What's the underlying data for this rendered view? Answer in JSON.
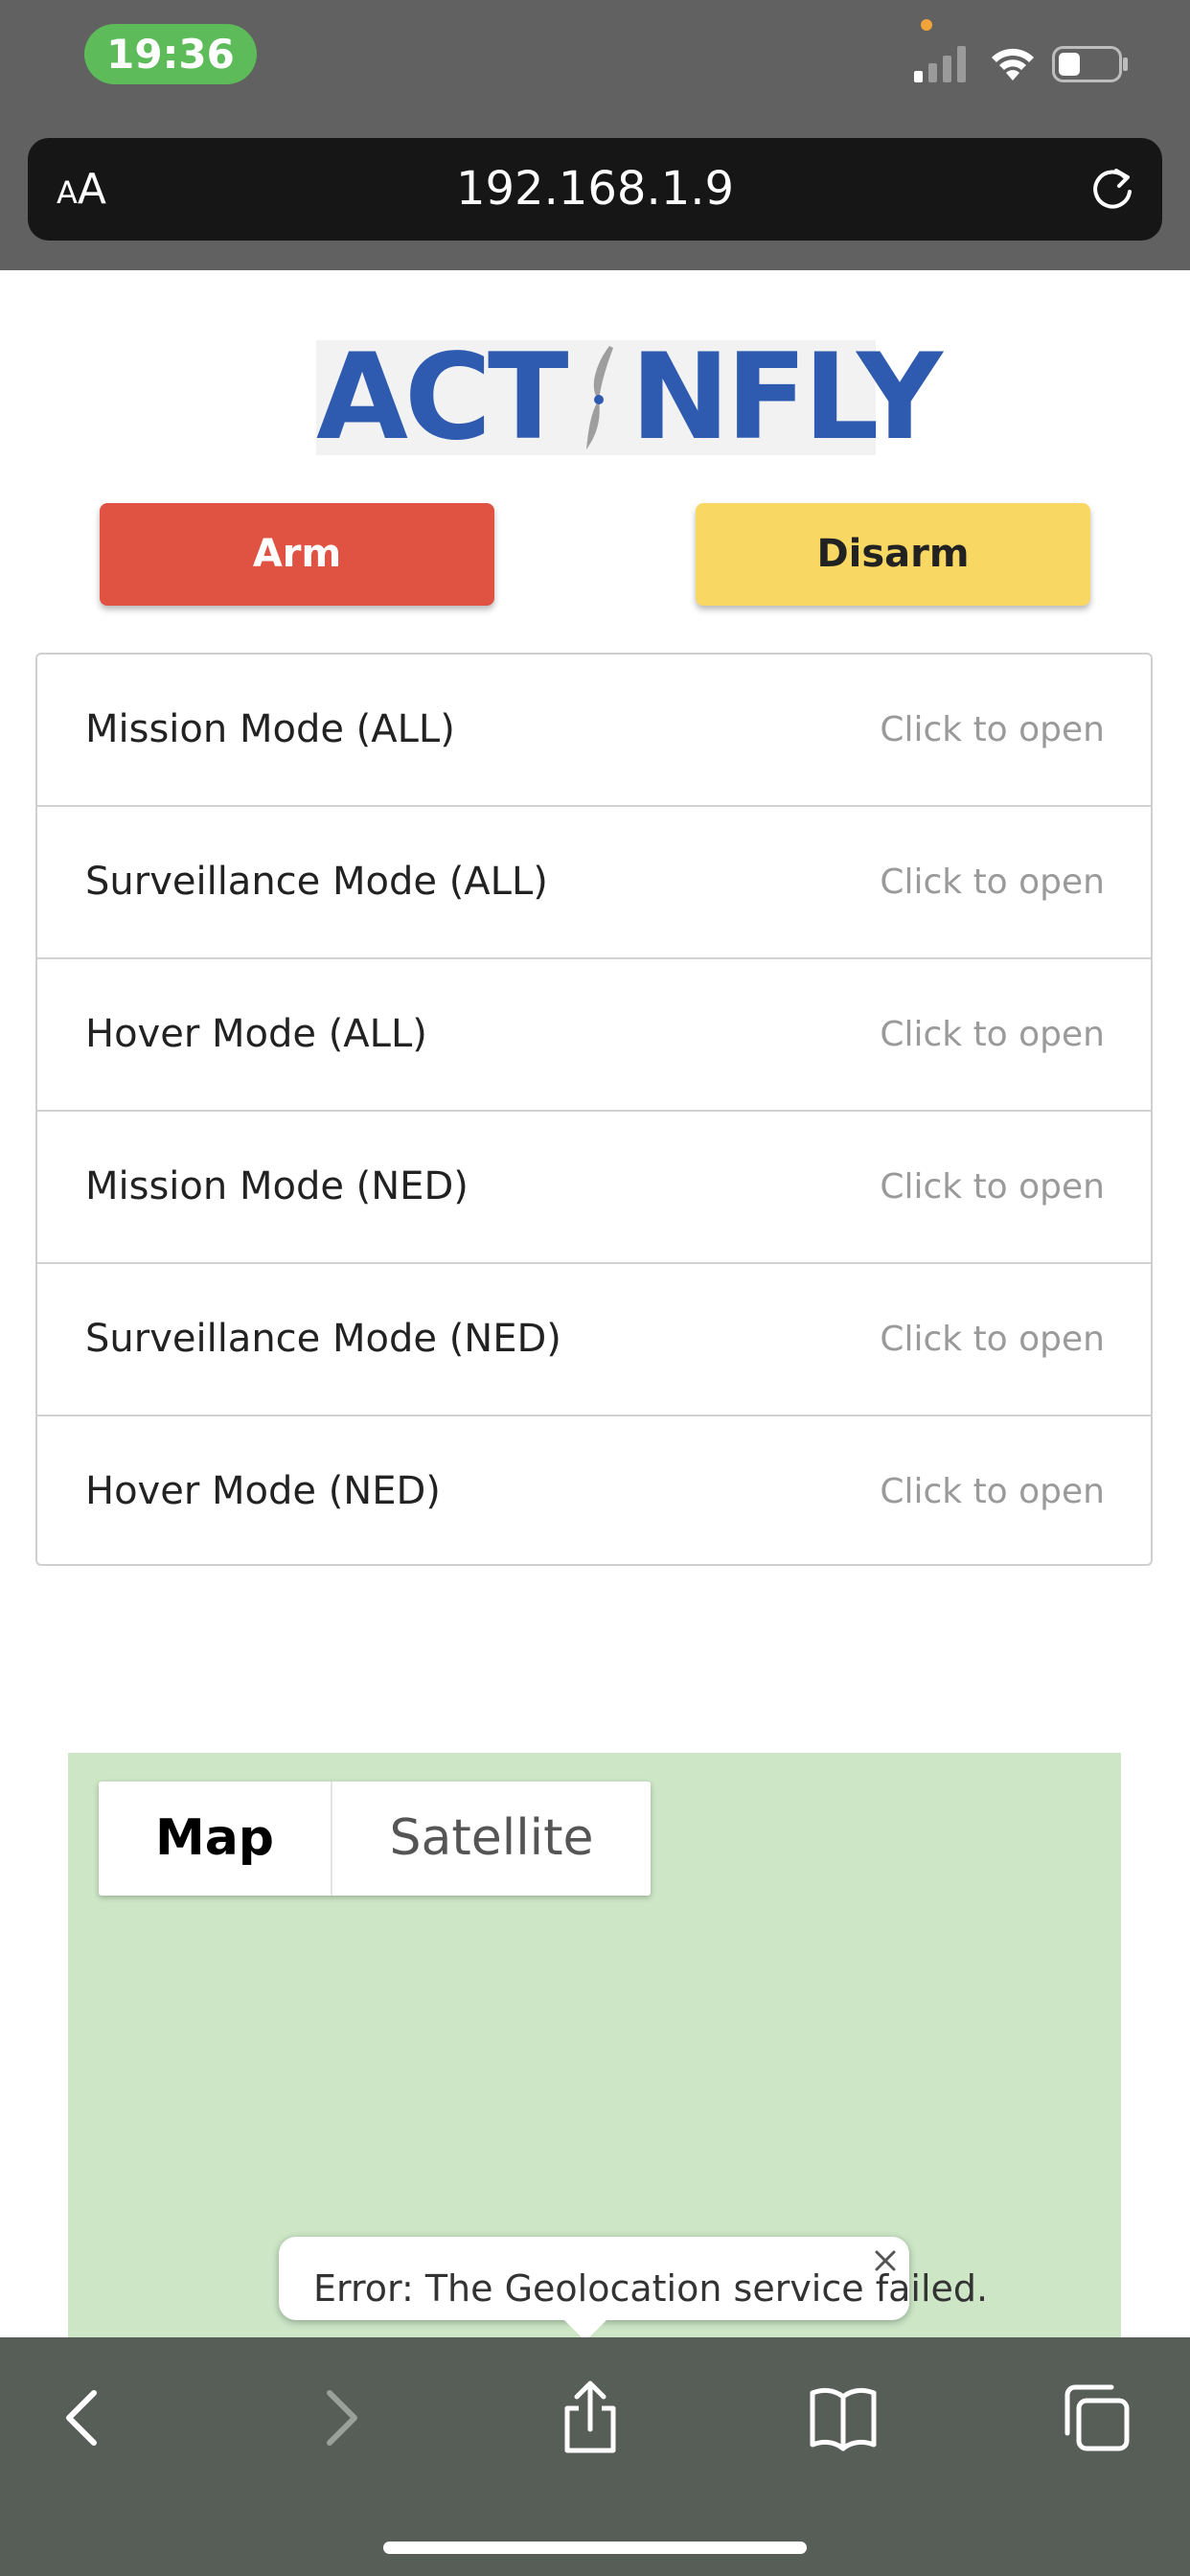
{
  "status_bar": {
    "time": "19:36",
    "colors": {
      "time_pill": "#5dbb5a",
      "indicator_dot": "#f2a33a"
    }
  },
  "browser": {
    "text_size_small": "A",
    "text_size_large": "A",
    "url": "192.168.1.9",
    "reload_icon": "reload-icon"
  },
  "logo": {
    "left": "ACT",
    "right": "NFLY",
    "colors": {
      "blue": "#2e5bb0",
      "gray": "#9e9e9e"
    }
  },
  "actions": {
    "arm_label": "Arm",
    "disarm_label": "Disarm",
    "colors": {
      "arm": "#e05343",
      "disarm": "#f8d862"
    }
  },
  "modes": [
    {
      "label": "Mission Mode (ALL)",
      "action": "Click to open"
    },
    {
      "label": "Surveillance Mode (ALL)",
      "action": "Click to open"
    },
    {
      "label": "Hover Mode (ALL)",
      "action": "Click to open"
    },
    {
      "label": "Mission Mode (NED)",
      "action": "Click to open"
    },
    {
      "label": "Surveillance Mode (NED)",
      "action": "Click to open"
    },
    {
      "label": "Hover Mode (NED)",
      "action": "Click to open"
    }
  ],
  "map": {
    "type_options": [
      "Map",
      "Satellite"
    ],
    "selected": "Map",
    "background_color": "#cce6c6",
    "info_window": "Error: The Geolocation service failed."
  },
  "toolbar": {
    "icons": [
      "back-icon",
      "forward-icon",
      "share-icon",
      "bookmarks-icon",
      "tabs-icon"
    ]
  }
}
